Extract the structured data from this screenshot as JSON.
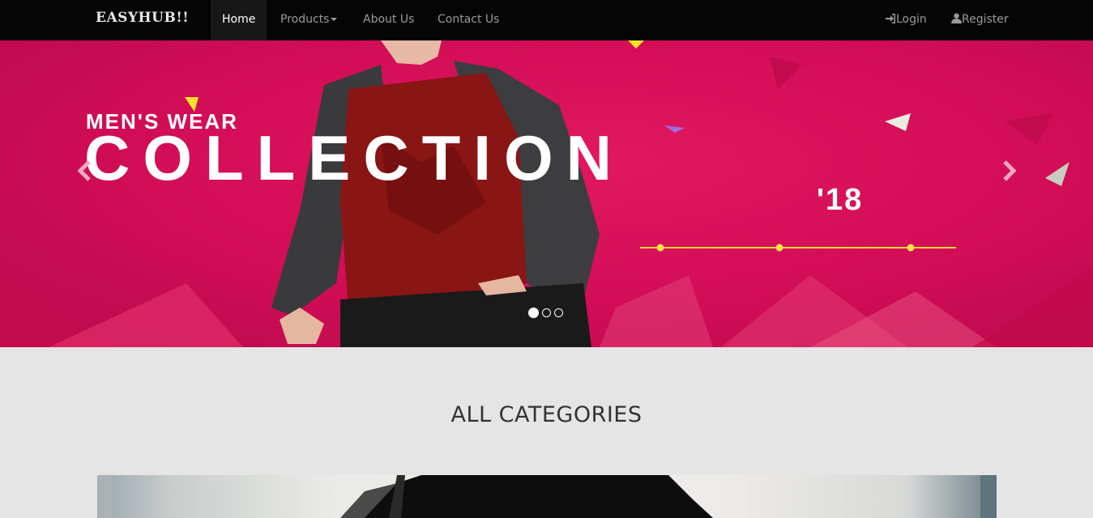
{
  "navbar": {
    "brand": "EASYHUB!!",
    "items": [
      {
        "label": "Home"
      },
      {
        "label": "Products"
      },
      {
        "label": "About Us"
      },
      {
        "label": "Contact Us"
      }
    ],
    "login": "Login",
    "register": "Register"
  },
  "carousel": {
    "line1": "MEN'S WEAR",
    "line2": "COLLECTION",
    "line3": "'18",
    "slide_count": 3,
    "active_slide": 1,
    "prev_icon": "chevron-left-icon",
    "next_icon": "chevron-right-icon"
  },
  "categories": {
    "title": "ALL CATEGORIES"
  },
  "colors": {
    "navbar_bg": "#050505",
    "banner_pink": "#d10d55",
    "page_bg": "#e5e5e5"
  }
}
